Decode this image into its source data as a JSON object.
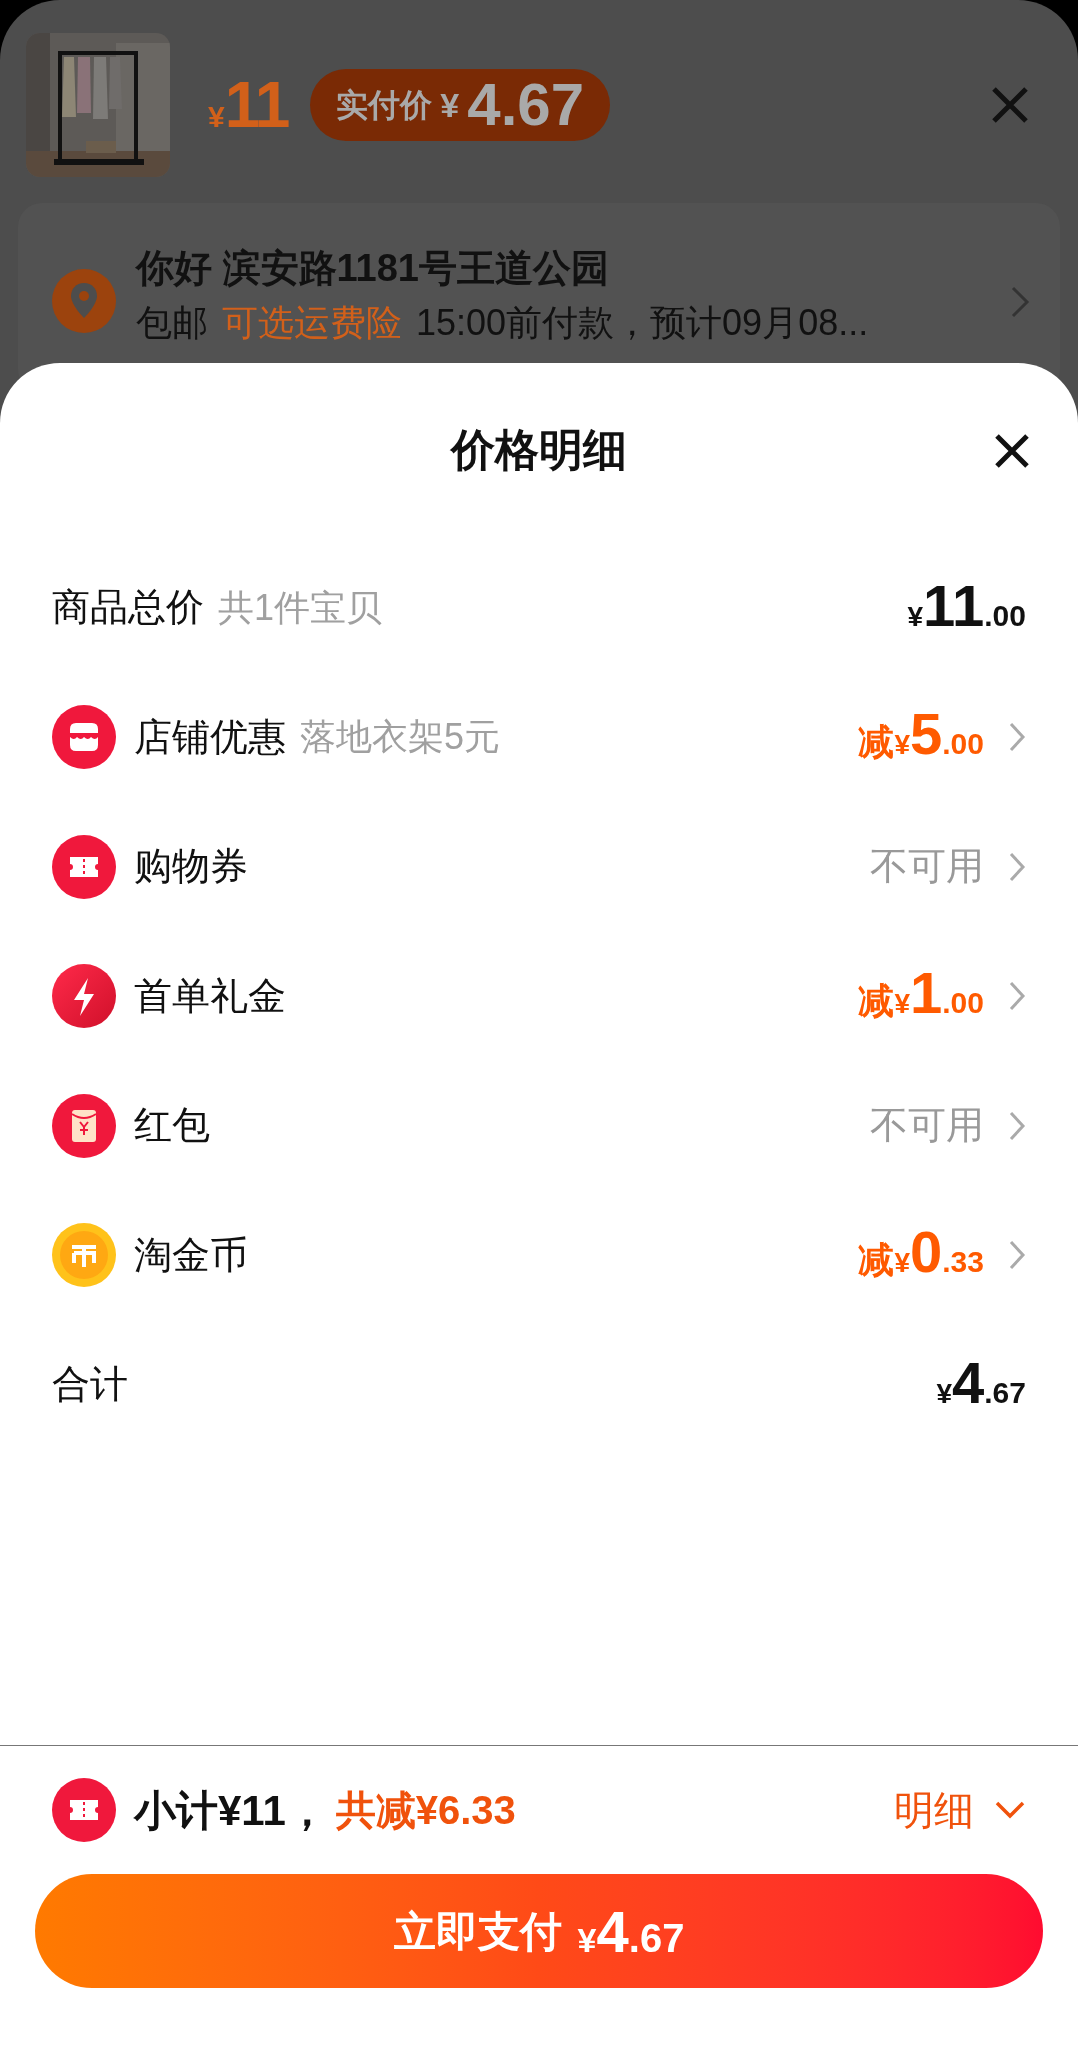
{
  "product": {
    "price": {
      "yen": "¥",
      "int": "11"
    },
    "paid_badge": {
      "label": "实付价",
      "yen": "¥",
      "amount": "4.67"
    }
  },
  "address": {
    "title": "你好 滨安路1181号王道公园",
    "shipping": "包邮",
    "insurance": "可选运费险",
    "delivery": "15:00前付款，预计09月08..."
  },
  "sheet": {
    "title": "价格明细",
    "total_row": {
      "label": "商品总价",
      "note": "共1件宝贝",
      "yen": "¥",
      "int": "11",
      "dec": ".00"
    },
    "rows": [
      {
        "kind": "amount",
        "label": "店铺优惠",
        "note": "落地衣架5元",
        "prefix": "减",
        "yen": "¥",
        "int": "5",
        "dec": ".00"
      },
      {
        "kind": "status",
        "label": "购物券",
        "status": "不可用"
      },
      {
        "kind": "amount",
        "label": "首单礼金",
        "prefix": "减",
        "yen": "¥",
        "int": "1",
        "dec": ".00"
      },
      {
        "kind": "status",
        "label": "红包",
        "status": "不可用"
      },
      {
        "kind": "amount",
        "label": "淘金币",
        "prefix": "减",
        "yen": "¥",
        "int": "0",
        "dec": ".33"
      }
    ],
    "sum_row": {
      "label": "合计",
      "yen": "¥",
      "int": "4",
      "dec": ".67"
    }
  },
  "footer": {
    "subtotal": "小计¥11，",
    "discount": "共减¥6.33",
    "details": "明细",
    "pay_button": {
      "label": "立即支付",
      "yen": "¥",
      "int": "4",
      "dec": ".67"
    }
  }
}
